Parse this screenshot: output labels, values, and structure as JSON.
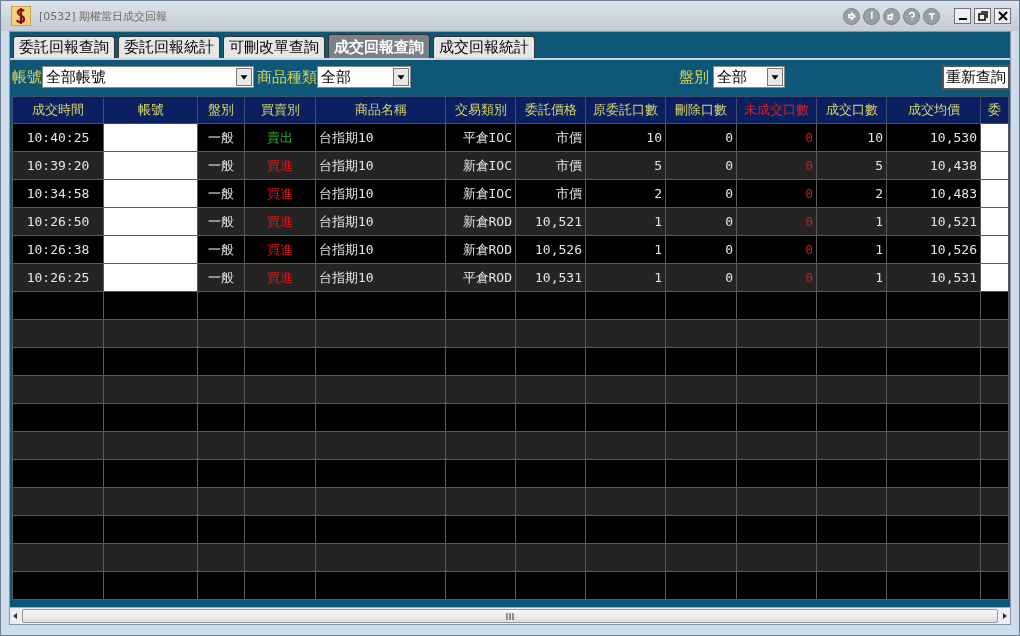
{
  "window": {
    "title": "[0532] 期權當日成交回報"
  },
  "tabs": [
    {
      "label": "委託回報查詢",
      "selected": false
    },
    {
      "label": "委託回報統計",
      "selected": false
    },
    {
      "label": "可刪改單查詢",
      "selected": false
    },
    {
      "label": "成交回報查詢",
      "selected": true
    },
    {
      "label": "成交回報統計",
      "selected": false
    }
  ],
  "filters": {
    "account_label": "帳號",
    "account_value": "全部帳號",
    "product_label": "商品種類",
    "product_value": "全部",
    "session_label": "盤別",
    "session_value": "全部",
    "requery_button": "重新查詢"
  },
  "table": {
    "columns": [
      {
        "label": "成交時間",
        "highlight": false
      },
      {
        "label": "帳號",
        "highlight": false
      },
      {
        "label": "盤別",
        "highlight": false
      },
      {
        "label": "買賣別",
        "highlight": false
      },
      {
        "label": "商品名稱",
        "highlight": false
      },
      {
        "label": "交易類別",
        "highlight": false
      },
      {
        "label": "委託價格",
        "highlight": false
      },
      {
        "label": "原委託口數",
        "highlight": false
      },
      {
        "label": "刪除口數",
        "highlight": false
      },
      {
        "label": "未成交口數",
        "highlight": true
      },
      {
        "label": "成交口數",
        "highlight": false
      },
      {
        "label": "成交均價",
        "highlight": false
      },
      {
        "label": "委",
        "highlight": false
      }
    ],
    "rows": [
      {
        "time": "10:40:25",
        "masked": true,
        "session": "一般",
        "side": "賣出",
        "kind": "sell",
        "product": "台指期10",
        "type": "平倉IOC",
        "price": "市價",
        "orig_qty": "10",
        "cancel_qty": "0",
        "unfilled_qty": "0",
        "filled_qty": "10",
        "avg_price": "10,530"
      },
      {
        "time": "10:39:20",
        "masked": true,
        "session": "一般",
        "side": "買進",
        "kind": "buy",
        "product": "台指期10",
        "type": "新倉IOC",
        "price": "市價",
        "orig_qty": "5",
        "cancel_qty": "0",
        "unfilled_qty": "0",
        "filled_qty": "5",
        "avg_price": "10,438"
      },
      {
        "time": "10:34:58",
        "masked": true,
        "session": "一般",
        "side": "買進",
        "kind": "buy",
        "product": "台指期10",
        "type": "新倉IOC",
        "price": "市價",
        "orig_qty": "2",
        "cancel_qty": "0",
        "unfilled_qty": "0",
        "filled_qty": "2",
        "avg_price": "10,483"
      },
      {
        "time": "10:26:50",
        "masked": true,
        "session": "一般",
        "side": "買進",
        "kind": "buy",
        "product": "台指期10",
        "type": "新倉ROD",
        "price": "10,521",
        "orig_qty": "1",
        "cancel_qty": "0",
        "unfilled_qty": "0",
        "filled_qty": "1",
        "avg_price": "10,521"
      },
      {
        "time": "10:26:38",
        "masked": true,
        "session": "一般",
        "side": "買進",
        "kind": "buy",
        "product": "台指期10",
        "type": "新倉ROD",
        "price": "10,526",
        "orig_qty": "1",
        "cancel_qty": "0",
        "unfilled_qty": "0",
        "filled_qty": "1",
        "avg_price": "10,526"
      },
      {
        "time": "10:26:25",
        "masked": true,
        "session": "一般",
        "side": "買進",
        "kind": "buy",
        "product": "台指期10",
        "type": "平倉ROD",
        "price": "10,531",
        "orig_qty": "1",
        "cancel_qty": "0",
        "unfilled_qty": "0",
        "filled_qty": "1",
        "avg_price": "10,531"
      }
    ]
  }
}
